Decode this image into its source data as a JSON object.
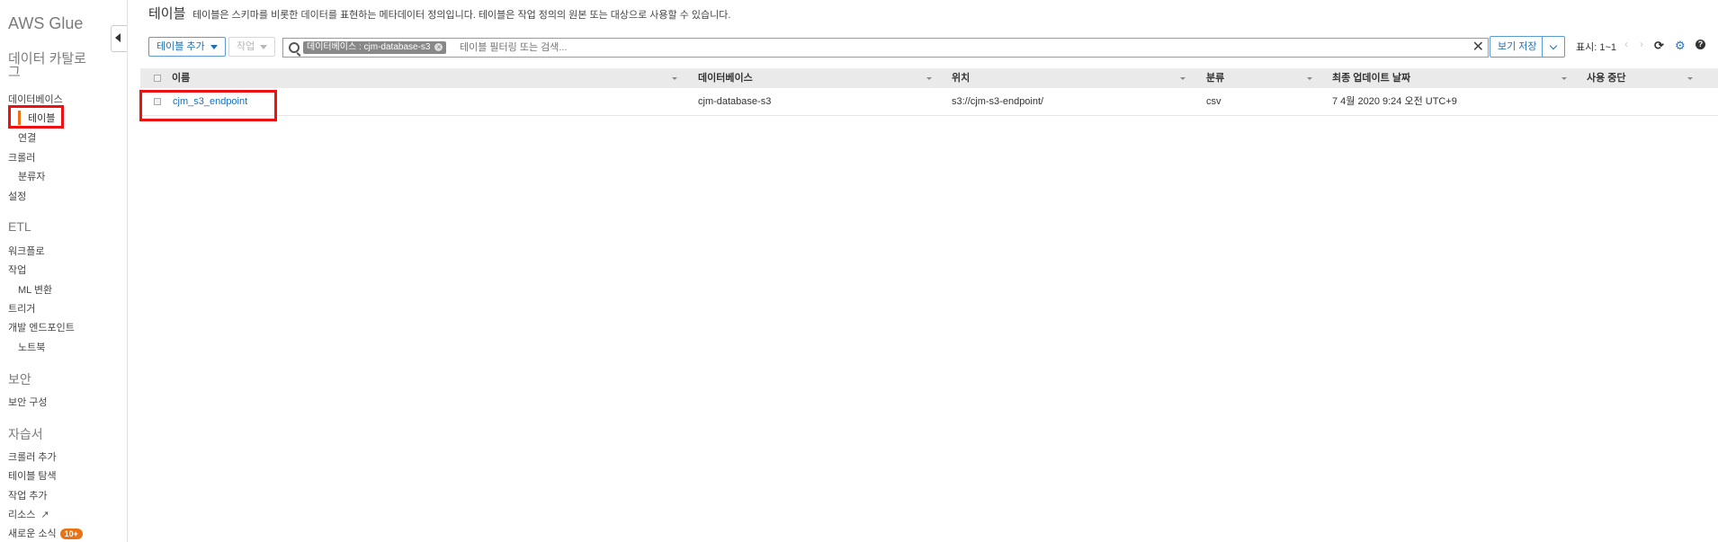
{
  "sidebar": {
    "title": "AWS Glue",
    "sections": {
      "catalog": "데이터 카탈로\n그",
      "etl": "ETL",
      "security": "보안",
      "tutorials": "자습서"
    },
    "items": {
      "databases": "데이터베이스",
      "tables": "테이블",
      "connections": "연결",
      "crawlers": "크롤러",
      "classifiers": "분류자",
      "settings": "설정",
      "workflows": "워크플로",
      "jobs": "작업",
      "ml_transforms": "ML 변환",
      "triggers": "트리거",
      "dev_endpoints": "개발 엔드포인트",
      "notebooks": "노트북",
      "security_config": "보안 구성",
      "add_crawler": "크롤러 추가",
      "explore_table": "테이블 탐색",
      "add_job": "작업 추가",
      "resources": "리소스",
      "whats_new": "새로운 소식",
      "whats_new_badge": "10+"
    }
  },
  "header": {
    "title": "테이블",
    "description": "테이블은 스키마를 비롯한 데이터를 표현하는 메타데이터 정의입니다. 테이블은 작업 정의의 원본 또는 대상으로 사용할 수 있습니다."
  },
  "toolbar": {
    "add_table": "테이블 추가",
    "action": "작업",
    "filter_token": "데이터베이스 : cjm-database-s3",
    "filter_token_close": "×",
    "filter_placeholder": "테이블 필터링 또는 검색...",
    "filter_clear": "✕",
    "save_view": "보기 저장",
    "pager": "표시: 1~1",
    "prev": "‹",
    "next": "›",
    "refresh_glyph": "⟳",
    "settings_glyph": "⚙",
    "help_glyph": "?",
    "ext_glyph": "↗"
  },
  "table": {
    "columns": [
      "이름",
      "데이터베이스",
      "위치",
      "분류",
      "최종 업데이트 날짜",
      "사용 중단"
    ],
    "rows": [
      {
        "name": "cjm_s3_endpoint",
        "database": "cjm-database-s3",
        "location": "s3://cjm-s3-endpoint/",
        "classification": "csv",
        "last_updated": "7 4월 2020 9:24 오전 UTC+9",
        "deprecated": ""
      }
    ]
  },
  "colors": {
    "accent_orange": "#ec7211",
    "link_blue": "#1a6fc3",
    "highlight_red": "#ee1111",
    "settings_blue": "#1a75cf"
  }
}
